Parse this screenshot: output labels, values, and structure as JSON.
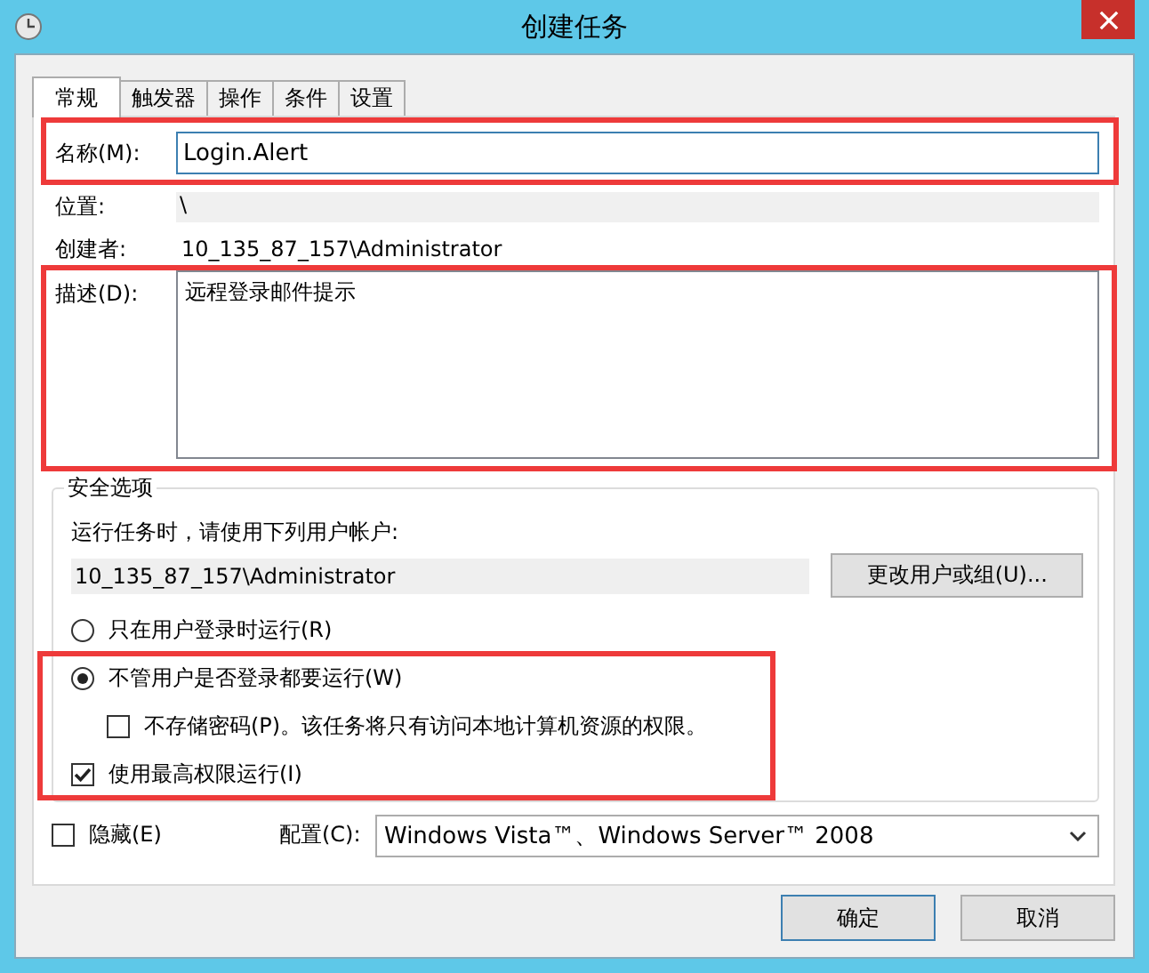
{
  "window": {
    "title": "创建任务"
  },
  "tabs": [
    {
      "label": "常规",
      "selected": true
    },
    {
      "label": "触发器",
      "selected": false
    },
    {
      "label": "操作",
      "selected": false
    },
    {
      "label": "条件",
      "selected": false
    },
    {
      "label": "设置",
      "selected": false
    }
  ],
  "general": {
    "name": {
      "label": "名称(M):",
      "value": "Login.Alert"
    },
    "location": {
      "label": "位置:",
      "value": "\\"
    },
    "author": {
      "label": "创建者:",
      "value": "10_135_87_157\\Administrator"
    },
    "description": {
      "label": "描述(D):",
      "value": "远程登录邮件提示"
    }
  },
  "security": {
    "title": "安全选项",
    "prompt": "运行任务时，请使用下列用户帐户:",
    "account": "10_135_87_157\\Administrator",
    "change_button": "更改用户或组(U)...",
    "options": [
      {
        "kind": "radio",
        "label": "只在用户登录时运行(R)",
        "checked": false
      },
      {
        "kind": "radio",
        "label": "不管用户是否登录都要运行(W)",
        "checked": true,
        "children": [
          {
            "kind": "checkbox",
            "label": "不存储密码(P)。该任务将只有访问本地计算机资源的权限。",
            "checked": false
          }
        ]
      },
      {
        "kind": "checkbox",
        "label": "使用最高权限运行(I)",
        "checked": true
      }
    ]
  },
  "hidden": {
    "label": "隐藏(E)",
    "checked": false
  },
  "configure": {
    "label": "配置(C):",
    "value": "Windows Vista™、Windows Server™ 2008"
  },
  "buttons": [
    "确定",
    "取消"
  ]
}
